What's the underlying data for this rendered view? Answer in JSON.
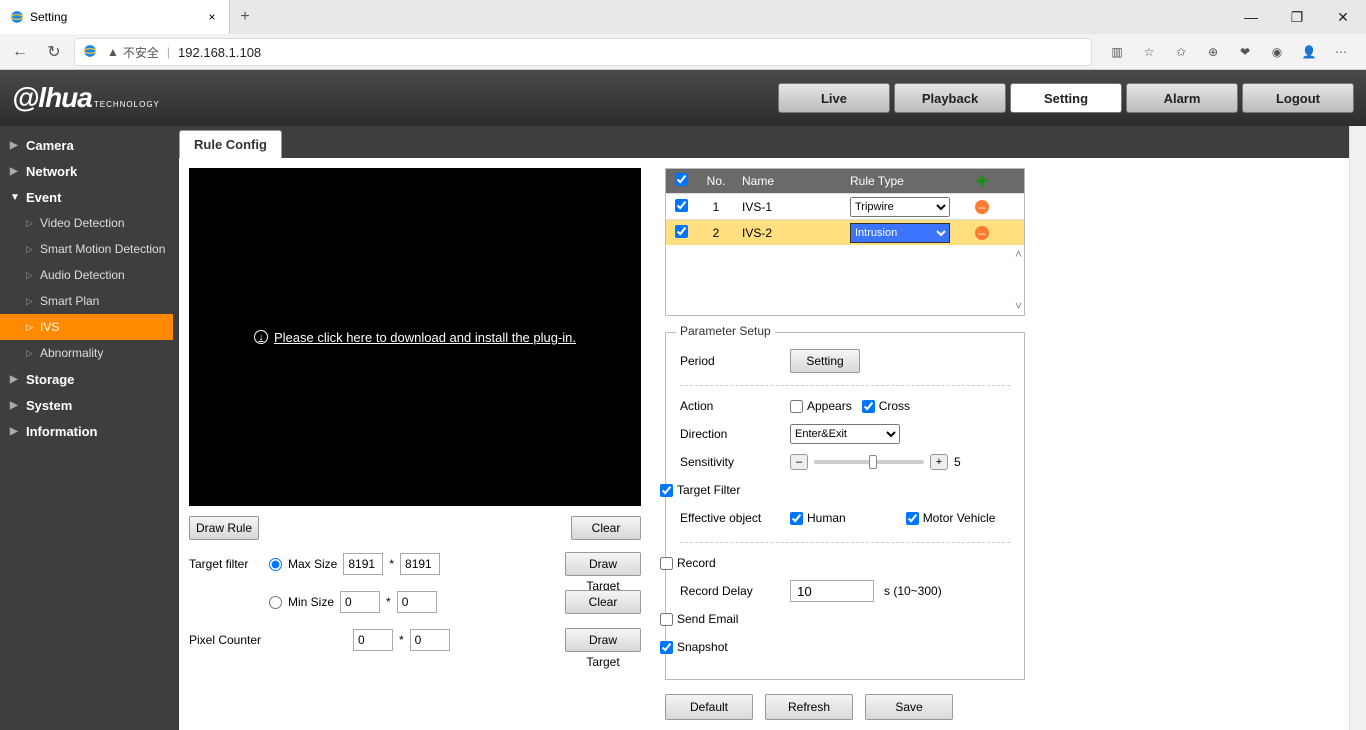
{
  "browser": {
    "tab_title": "Setting",
    "security_label": "不安全",
    "url": "192.168.1.108"
  },
  "topnav": {
    "live": "Live",
    "playback": "Playback",
    "setting": "Setting",
    "alarm": "Alarm",
    "logout": "Logout"
  },
  "sidebar": {
    "camera": "Camera",
    "network": "Network",
    "event": "Event",
    "storage": "Storage",
    "system": "System",
    "information": "Information",
    "event_children": {
      "video_detection": "Video Detection",
      "smart_motion": "Smart Motion Detection",
      "audio_detection": "Audio Detection",
      "smart_plan": "Smart Plan",
      "ivs": "IVS",
      "abnormality": "Abnormality"
    }
  },
  "content_tab": "Rule Config",
  "plugin_prompt": "Please click here to download and install the plug-in.",
  "buttons": {
    "draw_rule": "Draw Rule",
    "clear": "Clear",
    "draw_target": "Draw Target",
    "setting": "Setting",
    "default": "Default",
    "refresh": "Refresh",
    "save": "Save"
  },
  "filter": {
    "label": "Target filter",
    "max": "Max Size",
    "min": "Min Size",
    "max_w": "8191",
    "max_h": "8191",
    "min_w": "0",
    "min_h": "0",
    "pixel_label": "Pixel Counter",
    "pc_w": "0",
    "pc_h": "0",
    "mult": "*"
  },
  "rules": {
    "head": {
      "no": "No.",
      "name": "Name",
      "type": "Rule Type"
    },
    "rows": [
      {
        "no": "1",
        "name": "IVS-1",
        "type": "Tripwire"
      },
      {
        "no": "2",
        "name": "IVS-2",
        "type": "Intrusion"
      }
    ]
  },
  "param": {
    "legend": "Parameter Setup",
    "period": "Period",
    "action": "Action",
    "appears": "Appears",
    "cross": "Cross",
    "direction": "Direction",
    "direction_val": "Enter&Exit",
    "sensitivity": "Sensitivity",
    "sens_val": "5",
    "target_filter": "Target Filter",
    "effective": "Effective object",
    "human": "Human",
    "motor": "Motor Vehicle",
    "record": "Record",
    "record_delay": "Record Delay",
    "record_delay_val": "10",
    "record_delay_hint": "s (10~300)",
    "send_email": "Send Email",
    "snapshot": "Snapshot"
  }
}
